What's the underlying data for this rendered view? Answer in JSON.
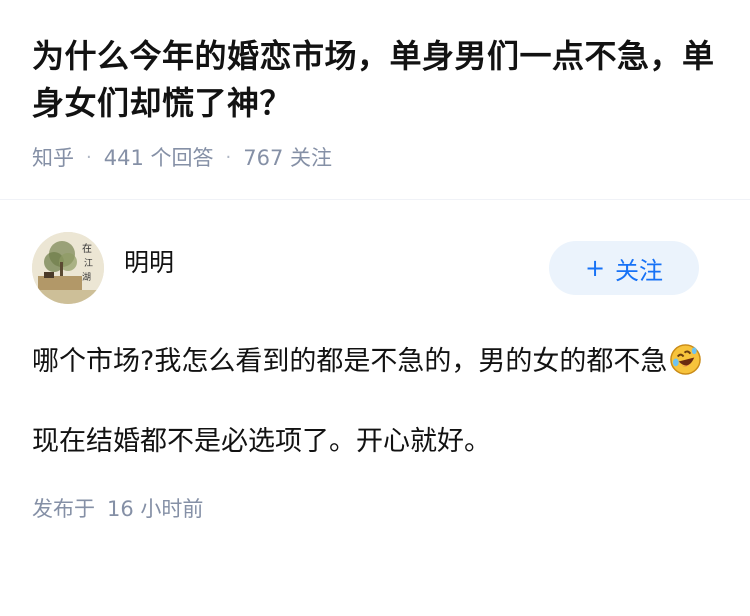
{
  "question": {
    "title": "为什么今年的婚恋市场，单身男们一点不急，单身女们却慌了神？",
    "source": "知乎",
    "answer_count": "441",
    "answer_label": "个回答",
    "follower_count": "767",
    "follower_label": "关注"
  },
  "answer": {
    "author_name": "明明",
    "avatar_icon": "landscape-painting-avatar",
    "follow_label": "关注",
    "paragraph_1": "哪个市场?我怎么看到的都是不急的，男的女的都不急",
    "emoji_icon": "rolling-on-floor-laughing-emoji",
    "paragraph_2": "现在结婚都不是必选项了。开心就好。",
    "published_label": "发布于",
    "published_time": "16 小时前"
  },
  "colors": {
    "accent": "#1772f6",
    "follow_bg": "#ebf3fc",
    "meta": "#8590a6"
  }
}
